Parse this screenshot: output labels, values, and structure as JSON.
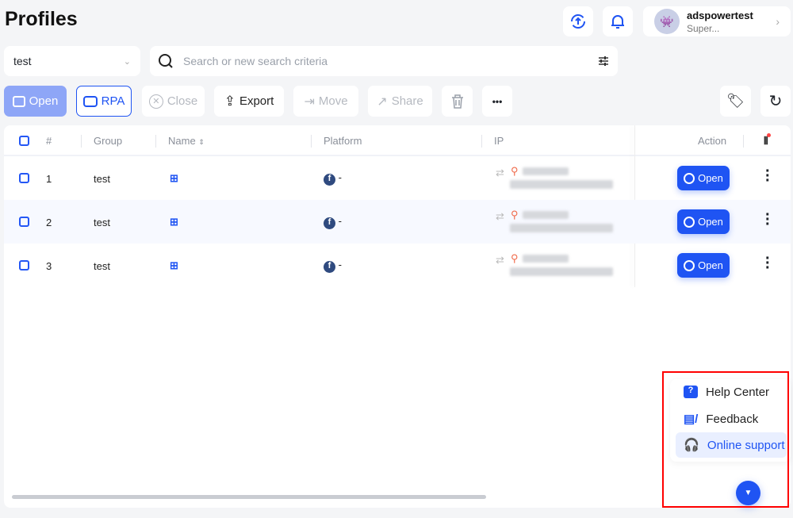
{
  "header": {
    "title": "Profiles",
    "user": {
      "name": "adspowertest",
      "role": "Super..."
    }
  },
  "filters": {
    "group_value": "test",
    "search_placeholder": "Search or new search criteria"
  },
  "toolbar": {
    "open": "Open",
    "rpa": "RPA",
    "close": "Close",
    "export": "Export",
    "move": "Move",
    "share": "Share",
    "more": "•••"
  },
  "table": {
    "columns": [
      "#",
      "Group",
      "Name",
      "Platform",
      "IP",
      "Action"
    ],
    "rows": [
      {
        "num": "1",
        "group": "test",
        "platform": "-",
        "action": "Open"
      },
      {
        "num": "2",
        "group": "test",
        "platform": "-",
        "action": "Open"
      },
      {
        "num": "3",
        "group": "test",
        "platform": "-",
        "action": "Open"
      }
    ]
  },
  "support_menu": {
    "items": [
      "Help Center",
      "Feedback",
      "Online support"
    ]
  },
  "colors": {
    "accent": "#1f54f3",
    "highlight_box": "#ff0000",
    "background": "#f4f5f7"
  }
}
